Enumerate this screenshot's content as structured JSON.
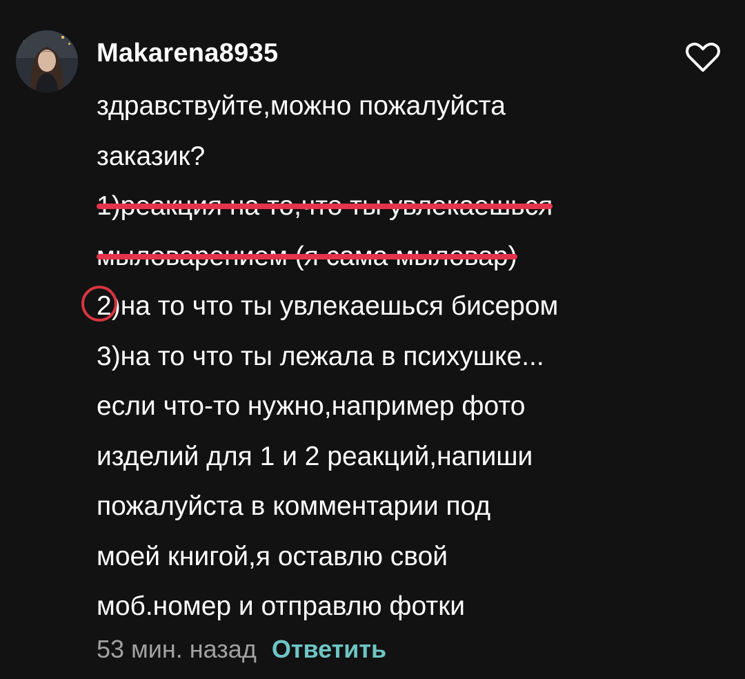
{
  "comment": {
    "username": "Makarena8935",
    "avatar_icon": "user-avatar-photo",
    "like_icon": "heart-outline-icon",
    "body_lines": [
      "здравствуйте,можно пожалуйста",
      "заказик?",
      "1)реакция на то,что ты увлекаешься",
      "мыловарением (я сама мыловар)",
      "2)на то что ты увлекаешься бисером",
      "3)на то что ты лежала в психушке...",
      "если что-то нужно,например фото",
      "изделий для 1 и 2 реакций,напиши",
      "пожалуйста в комментарии под",
      "моей книгой,я оставлю  свой",
      "моб.номер и отправлю фотки"
    ],
    "item2_number": "2",
    "item2_rest": ")на то что ты увлекаешься бисером",
    "timestamp": "53 мин. назад",
    "reply_label": "Ответить"
  },
  "colors": {
    "background": "#121212",
    "text": "#ffffff",
    "muted": "#a2a2a2",
    "accent_reply": "#6fc5c5",
    "strike": "#e5334b",
    "circle": "#d8353f"
  }
}
